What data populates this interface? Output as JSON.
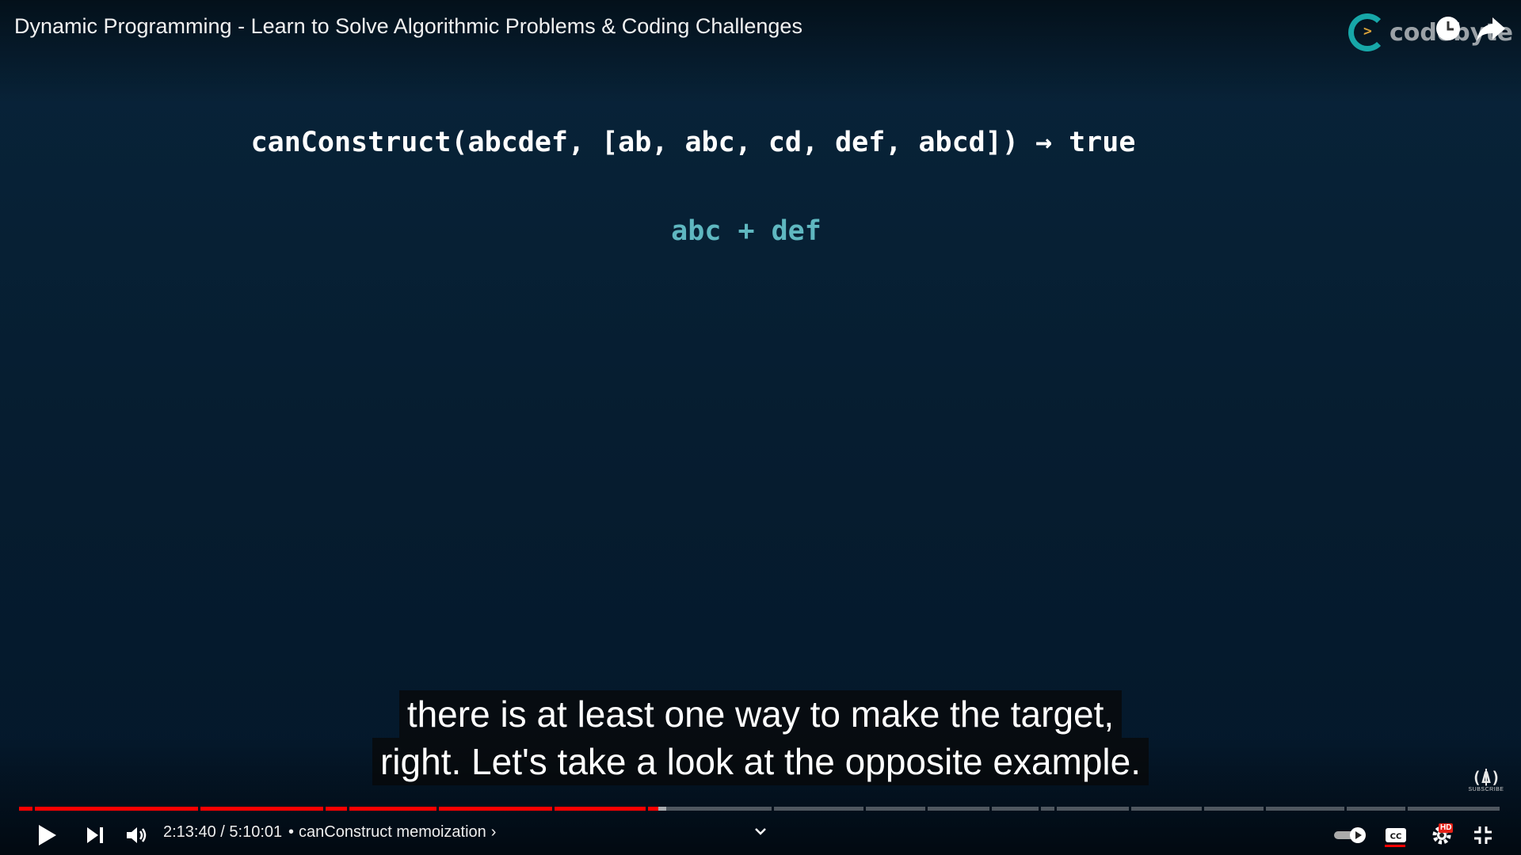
{
  "video": {
    "title": "Dynamic Programming - Learn to Solve Algorithmic Problems & Coding Challenges",
    "brand": "codebyte"
  },
  "slide": {
    "expression": "canConstruct(abcdef, [ab, abc, cd, def, abcd]) → true",
    "answer": "abc + def"
  },
  "captions": {
    "line1": "there is at least one way to make the target,",
    "line2": "right. Let's take a look at the opposite example."
  },
  "channel_badge": {
    "symbol": "(⍋)",
    "label": "SUBSCRIBE"
  },
  "player": {
    "current_time": "2:13:40",
    "duration": "5:10:01",
    "time_separator": " / ",
    "chapter_separator": "•",
    "chapter": "canConstruct memoization",
    "chapter_chevron": "›",
    "progress_fraction": 0.431,
    "hd_label": "HD",
    "colors": {
      "played": "#ff0000",
      "unplayed": "rgba(255,255,255,0.3)",
      "slide_answer": "#5fb7c0",
      "brand_ring": "#17a7a8"
    },
    "icons": {
      "play": "play-icon",
      "next": "next-icon",
      "volume": "volume-icon",
      "autoplay": "autoplay-toggle-icon",
      "captions": "cc-icon",
      "settings": "gear-icon",
      "exit_fullscreen": "exit-fullscreen-icon",
      "watch_later": "clock-icon",
      "share": "share-icon",
      "chapters_menu": "chevron-down-icon"
    }
  }
}
